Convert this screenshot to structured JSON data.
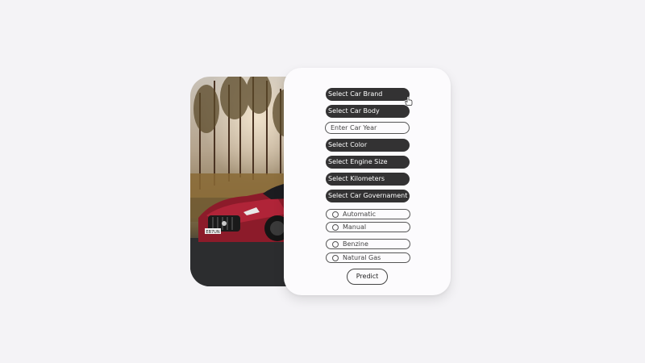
{
  "form": {
    "car_brand": "Select Car Brand",
    "car_body": "Select Car Body",
    "car_year_placeholder": "Enter Car Year",
    "color": "Select Color",
    "engine_size": "Select Engine Size",
    "kilometers": "Select Kilometers",
    "car_government": "Select Car Governament",
    "transmission_options": [
      "Automatic",
      "Manual"
    ],
    "fuel_options": [
      "Benzine",
      "Natural Gas"
    ],
    "predict_label": "Predict"
  },
  "photo": {
    "plate_text": "EB7UN"
  },
  "colors": {
    "select_bg": "#333233",
    "card_bg": "#fcfbfd",
    "page_bg": "#f4f3f6"
  }
}
